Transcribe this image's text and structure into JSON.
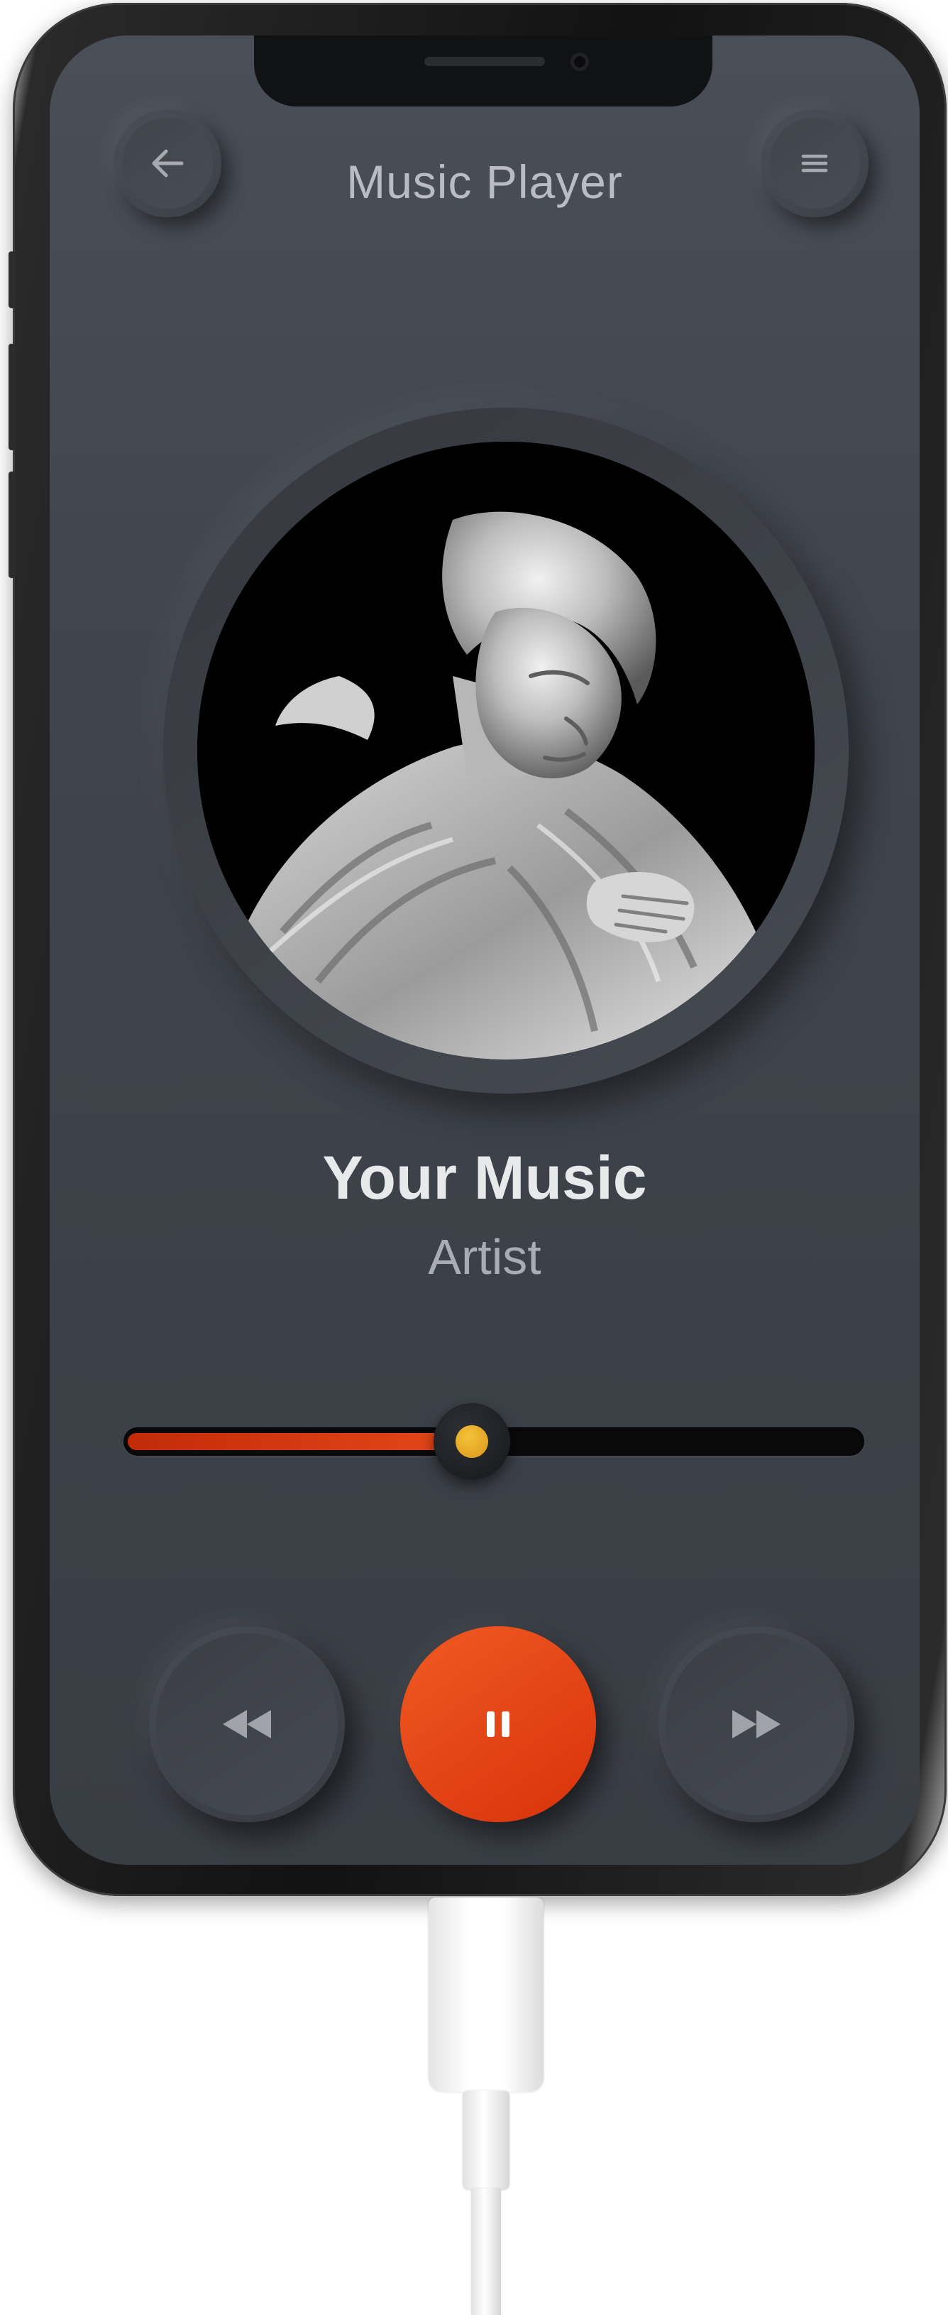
{
  "header": {
    "title": "Music Player",
    "back_icon": "arrow-left-icon",
    "menu_icon": "hamburger-menu-icon"
  },
  "track": {
    "title": "Your Music",
    "artist": "Artist",
    "artwork": "marble-statue-artwork"
  },
  "playback": {
    "progress_fraction": 0.47,
    "state": "playing",
    "rewind_icon": "rewind-icon",
    "pause_icon": "pause-icon",
    "forward_icon": "fast-forward-icon"
  },
  "colors": {
    "accent": "#e5481a",
    "knob": "#f0b52c",
    "background": "#40444c",
    "title_text": "#e8e9eb",
    "muted_text": "#a9adb3"
  }
}
